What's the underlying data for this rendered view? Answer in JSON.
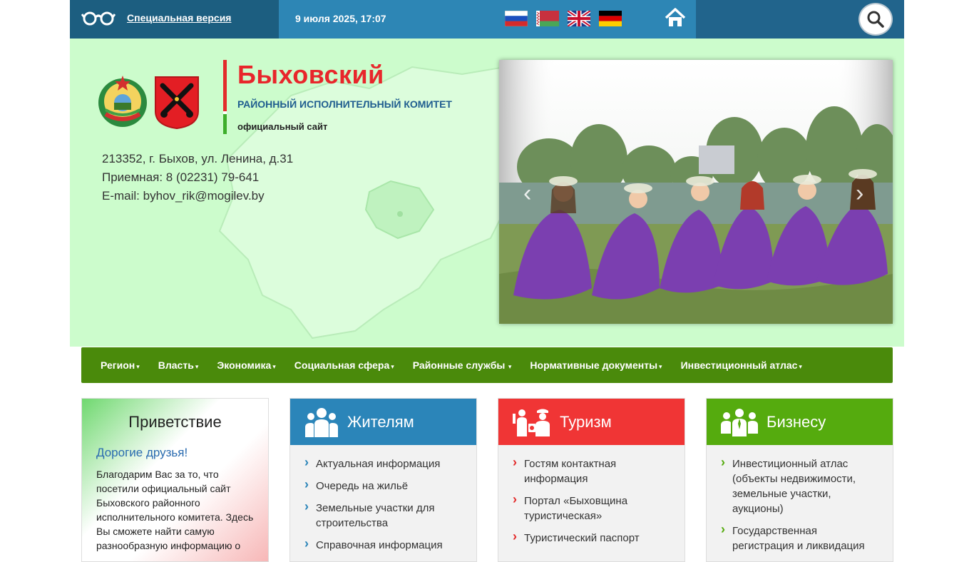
{
  "topbar": {
    "special_version": "Специальная версия",
    "datetime": "9 июля 2025, 17:07",
    "flags": [
      "flag-ru-icon",
      "flag-by-icon",
      "flag-uk-icon",
      "flag-de-icon"
    ]
  },
  "header": {
    "title": "Быховский",
    "subtitle": "РАЙОННЫЙ ИСПОЛНИТЕЛЬНЫЙ КОМИТЕТ",
    "official": "официальный сайт",
    "address": "213352, г. Быхов, ул. Ленина, д.31",
    "reception": "Приемная: 8 (02231) 79-641",
    "email": "E-mail: byhov_rik@mogilev.by"
  },
  "nav": {
    "items": [
      "Регион",
      "Власть",
      "Экономика",
      "Социальная сфера",
      "Районные службы",
      "Нормативные документы",
      "Инвестиционный атлас"
    ]
  },
  "greeting": {
    "title": "Приветствие",
    "subtitle": "Дорогие друзья!",
    "text": "Благодарим Вас за то, что посетили официальный сайт Быховского районного исполнительного комитета. Здесь Вы сможете найти самую разнообразную информацию о"
  },
  "residents": {
    "title": "Жителям",
    "items": [
      "Актуальная информация",
      "Очередь на жильё",
      "Земельные участки для строительства",
      "Справочная информация"
    ]
  },
  "tourism": {
    "title": "Туризм",
    "items": [
      "Гостям контактная информация",
      "Портал «Быховщина туристическая»",
      "Туристический паспорт"
    ]
  },
  "business": {
    "title": "Бизнесу",
    "items": [
      "Инвестиционный атлас (объекты недвижимости, земельные участки, аукционы)",
      "Государственная регистрация и ликвидация"
    ]
  },
  "colors": {
    "topbar": "#2d86b5",
    "header_bg": "#ccfccc",
    "nav": "#4a8a0b",
    "title_red": "#e8262b",
    "residents": "#2b85b9",
    "tourism": "#f03535",
    "business": "#55ab0e"
  }
}
